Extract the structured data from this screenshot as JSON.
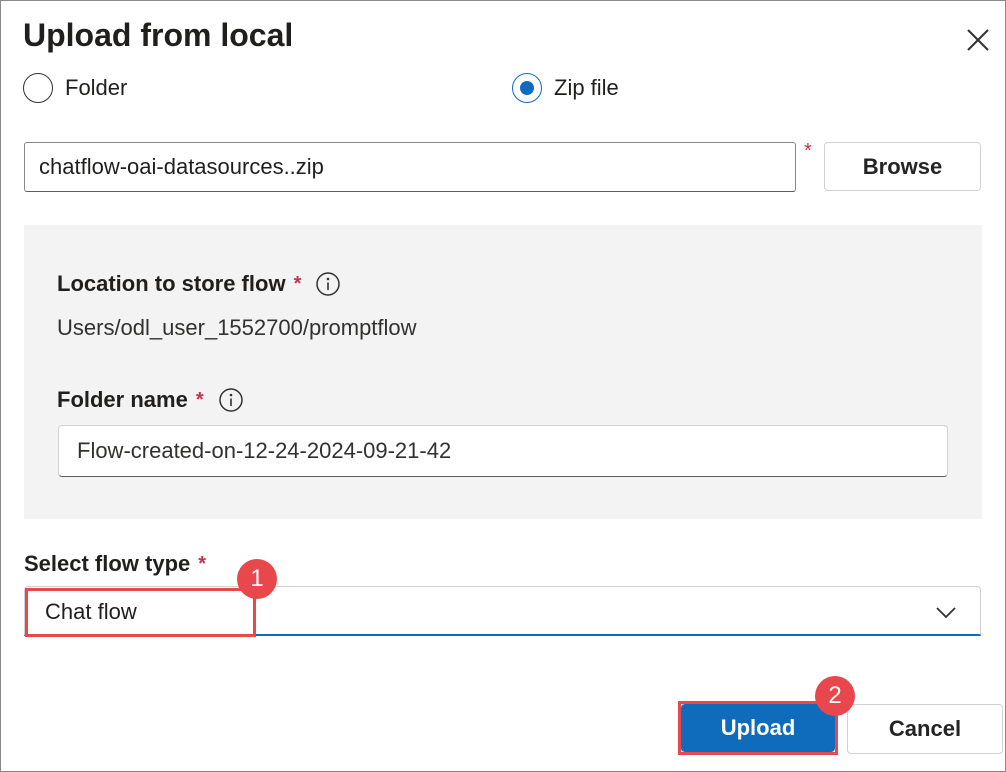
{
  "dialog": {
    "title": "Upload from local",
    "close_icon": "close-icon"
  },
  "source_type": {
    "options": [
      {
        "label": "Folder",
        "selected": false
      },
      {
        "label": "Zip file",
        "selected": true
      }
    ]
  },
  "file": {
    "value": "chatflow-oai-datasources..zip",
    "required_marker": "*",
    "browse_label": "Browse"
  },
  "location": {
    "label": "Location to store flow",
    "required_marker": "*",
    "info_icon": "info-icon",
    "value": "Users/odl_user_1552700/promptflow"
  },
  "folder_name": {
    "label": "Folder name",
    "required_marker": "*",
    "info_icon": "info-icon",
    "value": "Flow-created-on-12-24-2024-09-21-42"
  },
  "flow_type": {
    "label": "Select flow type",
    "required_marker": "*",
    "selected": "Chat flow",
    "chevron_icon": "chevron-down-icon"
  },
  "actions": {
    "upload_label": "Upload",
    "cancel_label": "Cancel"
  },
  "annotations": {
    "step1": "1",
    "step2": "2",
    "color": "#e8474b"
  },
  "colors": {
    "accent": "#0f6cbd",
    "required": "#c4314b",
    "panel_bg": "#f3f3f3"
  }
}
